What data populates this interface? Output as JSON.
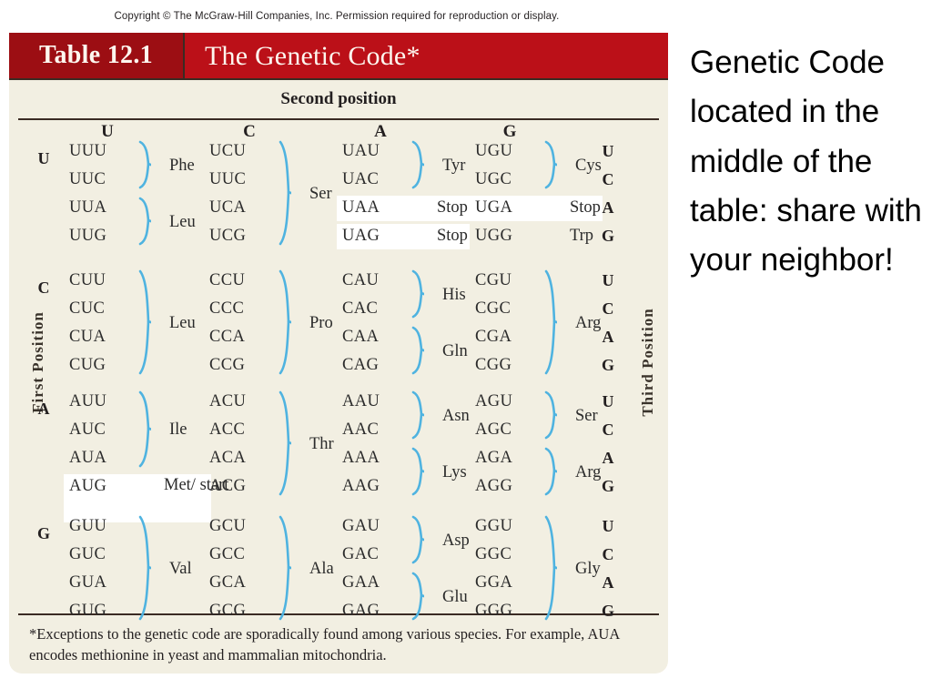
{
  "copyright": "Copyright © The McGraw-Hill Companies, Inc. Permission required for reproduction or display.",
  "table": {
    "number_label": "Table 12.1",
    "title": "The Genetic Code*",
    "second_position_label": "Second position",
    "first_position_label": "First Position",
    "third_position_label": "Third Position",
    "column_headers": [
      "U",
      "C",
      "A",
      "G"
    ],
    "row_labels": [
      "U",
      "C",
      "A",
      "G"
    ],
    "third_position_letters": [
      "U",
      "C",
      "A",
      "G"
    ],
    "footnote": "*Exceptions to the genetic code are sporadically found among various species. For example, AUA encodes methionine in yeast and mammalian mitochondria.",
    "cells": {
      "U": {
        "U": {
          "codons": [
            "UUU",
            "UUC",
            "UUA",
            "UUG"
          ],
          "groups": [
            {
              "label": "Phe",
              "rows": [
                0,
                1
              ]
            },
            {
              "label": "Leu",
              "rows": [
                2,
                3
              ]
            }
          ]
        },
        "C": {
          "codons": [
            "UCU",
            "UUC",
            "UCA",
            "UCG"
          ],
          "groups": [
            {
              "label": "Ser",
              "rows": [
                0,
                3
              ]
            }
          ]
        },
        "A": {
          "codons": [
            "UAU",
            "UAC",
            "UAA",
            "UAG"
          ],
          "groups": [
            {
              "label": "Tyr",
              "rows": [
                0,
                1
              ]
            }
          ],
          "singles": [
            {
              "label": "Stop",
              "row": 2,
              "highlight": true
            },
            {
              "label": "Stop",
              "row": 3,
              "highlight": true
            }
          ]
        },
        "G": {
          "codons": [
            "UGU",
            "UGC",
            "UGA",
            "UGG"
          ],
          "groups": [
            {
              "label": "Cys",
              "rows": [
                0,
                1
              ]
            }
          ],
          "singles": [
            {
              "label": "Stop",
              "row": 2,
              "highlight": true
            },
            {
              "label": "Trp",
              "row": 3,
              "highlight": false
            }
          ]
        }
      },
      "C": {
        "U": {
          "codons": [
            "CUU",
            "CUC",
            "CUA",
            "CUG"
          ],
          "groups": [
            {
              "label": "Leu",
              "rows": [
                0,
                3
              ]
            }
          ]
        },
        "C": {
          "codons": [
            "CCU",
            "CCC",
            "CCA",
            "CCG"
          ],
          "groups": [
            {
              "label": "Pro",
              "rows": [
                0,
                3
              ]
            }
          ]
        },
        "A": {
          "codons": [
            "CAU",
            "CAC",
            "CAA",
            "CAG"
          ],
          "groups": [
            {
              "label": "His",
              "rows": [
                0,
                1
              ]
            },
            {
              "label": "Gln",
              "rows": [
                2,
                3
              ]
            }
          ]
        },
        "G": {
          "codons": [
            "CGU",
            "CGC",
            "CGA",
            "CGG"
          ],
          "groups": [
            {
              "label": "Arg",
              "rows": [
                0,
                3
              ]
            }
          ]
        }
      },
      "A": {
        "U": {
          "codons": [
            "AUU",
            "AUC",
            "AUA",
            "AUG"
          ],
          "groups": [
            {
              "label": "Ile",
              "rows": [
                0,
                2
              ]
            }
          ],
          "singles": [
            {
              "label": "Met/ start",
              "row": 3,
              "highlight": true
            }
          ]
        },
        "C": {
          "codons": [
            "ACU",
            "ACC",
            "ACA",
            "ACG"
          ],
          "groups": [
            {
              "label": "Thr",
              "rows": [
                0,
                3
              ]
            }
          ]
        },
        "A": {
          "codons": [
            "AAU",
            "AAC",
            "AAA",
            "AAG"
          ],
          "groups": [
            {
              "label": "Asn",
              "rows": [
                0,
                1
              ]
            },
            {
              "label": "Lys",
              "rows": [
                2,
                3
              ]
            }
          ]
        },
        "G": {
          "codons": [
            "AGU",
            "AGC",
            "AGA",
            "AGG"
          ],
          "groups": [
            {
              "label": "Ser",
              "rows": [
                0,
                1
              ]
            },
            {
              "label": "Arg",
              "rows": [
                2,
                3
              ]
            }
          ]
        }
      },
      "G": {
        "U": {
          "codons": [
            "GUU",
            "GUC",
            "GUA",
            "GUG"
          ],
          "groups": [
            {
              "label": "Val",
              "rows": [
                0,
                3
              ]
            }
          ]
        },
        "C": {
          "codons": [
            "GCU",
            "GCC",
            "GCA",
            "GCG"
          ],
          "groups": [
            {
              "label": "Ala",
              "rows": [
                0,
                3
              ]
            }
          ]
        },
        "A": {
          "codons": [
            "GAU",
            "GAC",
            "GAA",
            "GAG"
          ],
          "groups": [
            {
              "label": "Asp",
              "rows": [
                0,
                1
              ]
            },
            {
              "label": "Glu",
              "rows": [
                2,
                3
              ]
            }
          ]
        },
        "G": {
          "codons": [
            "GGU",
            "GGC",
            "GGA",
            "GGG"
          ],
          "groups": [
            {
              "label": "Gly",
              "rows": [
                0,
                3
              ]
            }
          ]
        }
      }
    }
  },
  "callout": {
    "text": "Genetic Code located in the middle of the table: share with your neighbor!"
  },
  "colors": {
    "header_bar": "#bb1018",
    "header_number_box": "#9c0e13",
    "panel_background": "#f2efe2",
    "rule": "#3a2b23",
    "brace": "#4fb3e0",
    "text": "#231f20",
    "highlight": "#ffffff"
  }
}
